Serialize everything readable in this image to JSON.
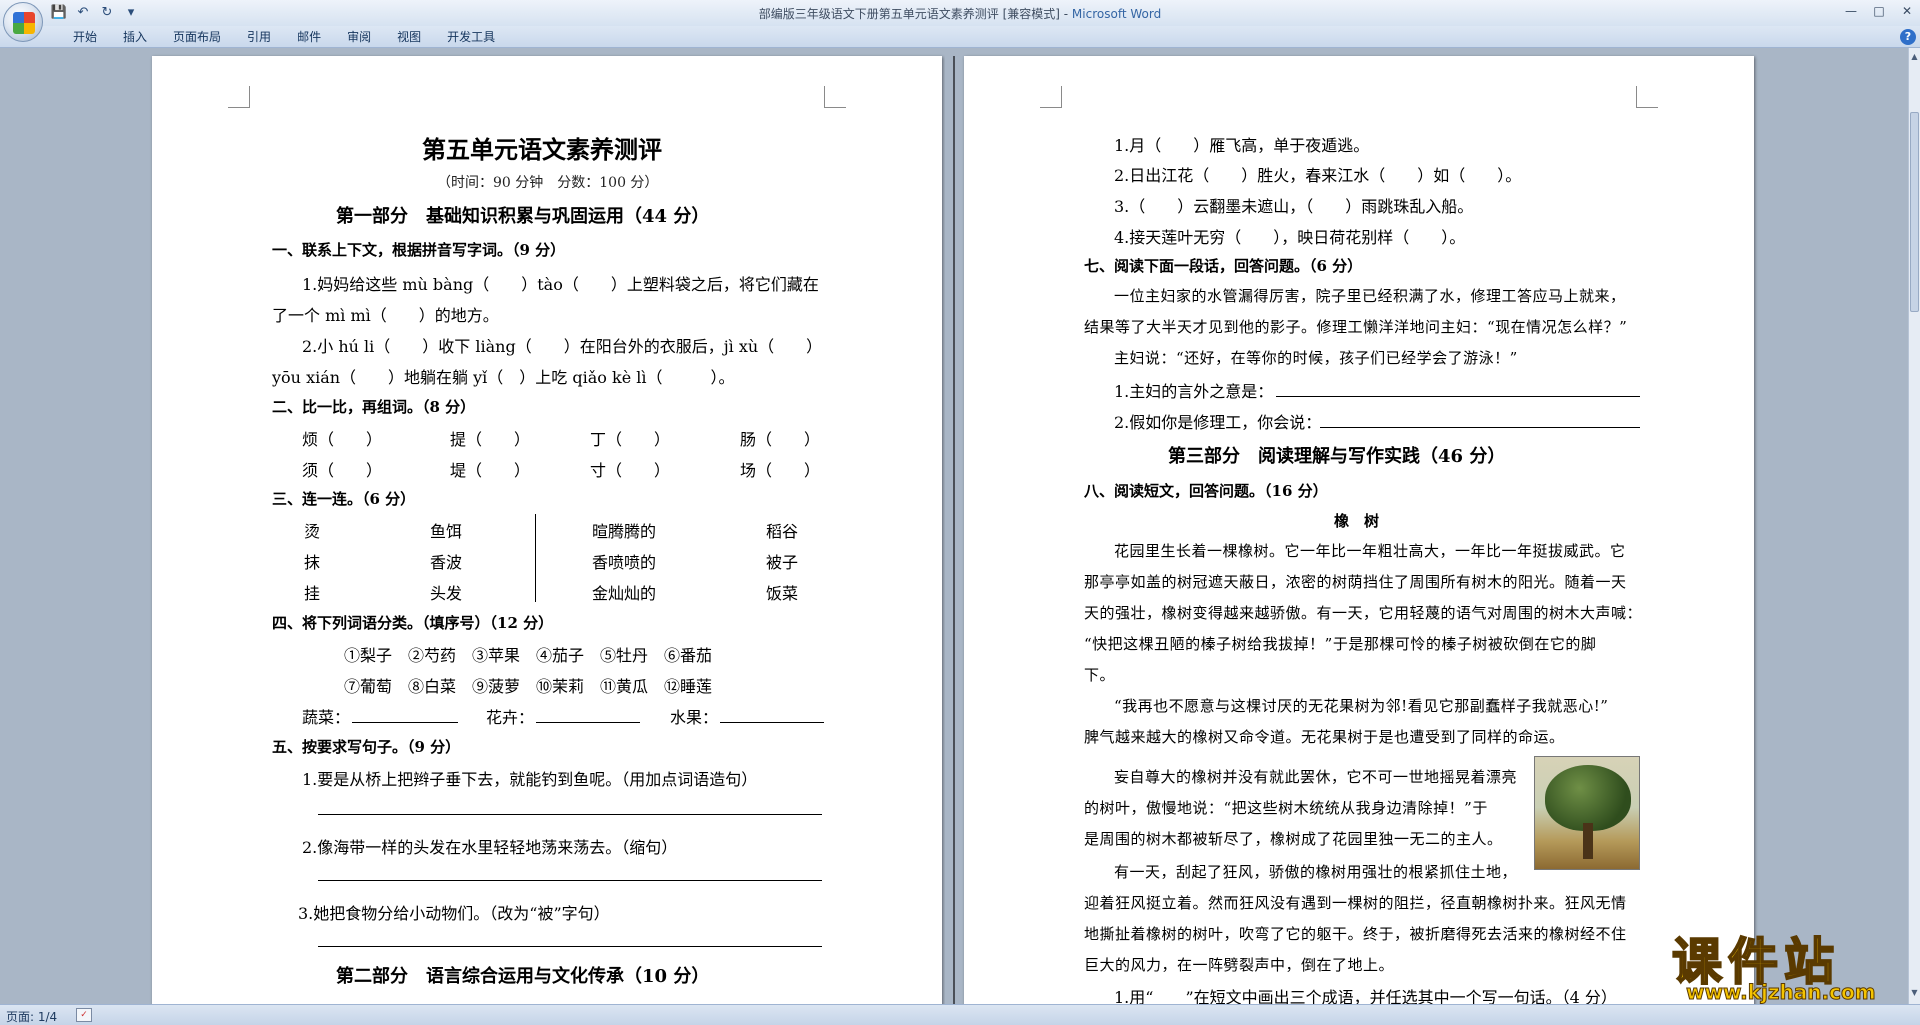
{
  "window": {
    "title": "部编版三年级语文下册第五单元语文素养测评 [兼容模式] - ",
    "app_name": "Microsoft Word"
  },
  "ribbon": {
    "tabs": [
      "开始",
      "插入",
      "页面布局",
      "引用",
      "邮件",
      "审阅",
      "视图",
      "开发工具"
    ],
    "help": "?"
  },
  "status": {
    "page": "页面: 1/4"
  },
  "watermark": {
    "text": "课件站",
    "url": "www.kjzhan.com"
  },
  "page_left": {
    "title": "第五单元语文素养测评",
    "subtitle": "（时间：90 分钟　分数：100 分）",
    "part1": "第一部分　基础知识积累与巩固运用（44 分）",
    "s1": "一、联系上下文，根据拼音写字词。（9 分）",
    "s1_l1": "1.妈妈给这些 mù bàng（　　）tào（　　）上塑料袋之后，将它们藏在",
    "s1_l2": "了一个 mì mì（　　）的地方。",
    "s1_l3": "2.小 hú li（　　）收下 liàng（　　）在阳台外的衣服后，jì xù（　　）",
    "s1_l4": "yōu xián（　　）地躺在躺 yǐ（　）上吃 qiǎo kè lì（　　　）。",
    "s2": "二、比一比，再组词。（8 分）",
    "s2_row1": [
      "烦（　　）",
      "提（　　）",
      "丁（　　）",
      "肠（　　）"
    ],
    "s2_row2": [
      "须（　　）",
      "堤（　　）",
      "寸（　　）",
      "场（　　）"
    ],
    "s3": "三、连一连。（6 分）",
    "s3_left": [
      "烫",
      "抹",
      "挂"
    ],
    "s3_left2": [
      "鱼饵",
      "香波",
      "头发"
    ],
    "s3_right": [
      "暄腾腾的",
      "香喷喷的",
      "金灿灿的"
    ],
    "s3_right2": [
      "稻谷",
      "被子",
      "饭菜"
    ],
    "s4": "四、将下列词语分类。（填序号）（12 分）",
    "s4_row1": "①梨子　②芍药　③苹果　④茄子　⑤牡丹　⑥番茄",
    "s4_row2": "⑦葡萄　⑧白菜　⑨菠萝　⑩茉莉　⑪黄瓜　⑫睡莲",
    "s4_veg": "蔬菜：",
    "s4_flower": "花卉：",
    "s4_fruit": "水果：",
    "s5": "五、按要求写句子。（9 分）",
    "s5_q1": "1.要是从桥上把辫子垂下去，就能钓到鱼呢。（用加点词语造句）",
    "s5_q2": "2.像海带一样的头发在水里轻轻地荡来荡去。（缩句）",
    "s5_q3": "3.她把食物分给小动物们。（改为“被”字句）",
    "part2": "第二部分　语言综合运用与文化传承（10 分）"
  },
  "page_right": {
    "r1": "1.月（　　）雁飞高，单于夜遁逃。",
    "r2": "2.日出江花（　　）胜火，春来江水（　　）如（　　）。",
    "r3": "3.（　　）云翻墨未遮山，（　　）雨跳珠乱入船。",
    "r4": "4.接天莲叶无穷（　　），映日荷花别样（　　）。",
    "s7": "七、阅读下面一段话，回答问题。（6 分）",
    "p7_1": "一位主妇家的水管漏得厉害，院子里已经积满了水，修理工答应马上就来，",
    "p7_2": "结果等了大半天才见到他的影子。修理工懒洋洋地问主妇：“现在情况怎么样？”",
    "p7_3": "主妇说：“还好，在等你的时候，孩子们已经学会了游泳！”",
    "q7_1": "1.主妇的言外之意是：",
    "q7_2": "2.假如你是修理工，你会说：",
    "part3": "第三部分　阅读理解与写作实践（46 分）",
    "s8": "八、阅读短文，回答问题。（16 分）",
    "story_title": "橡　树",
    "p1_1": "花园里生长着一棵橡树。它一年比一年粗壮高大，一年比一年挺拔威武。它",
    "p1_2": "那亭亭如盖的树冠遮天蔽日，浓密的树荫挡住了周围所有树木的阳光。随着一天",
    "p1_3": "天的强壮，橡树变得越来越骄傲。有一天，它用轻蔑的语气对周围的树木大声喊：",
    "p1_4": "“快把这棵丑陋的榛子树给我拔掉！”于是那棵可怜的榛子树被砍倒在它的脚",
    "p1_5": "下。",
    "p2_1": "“我再也不愿意与这棵讨厌的无花果树为邻!看见它那副蠢样子我就恶心!”",
    "p2_2": "脾气越来越大的橡树又命令道。无花果树于是也遭受到了同样的命运。",
    "p3_1": "妄自尊大的橡树并没有就此罢休，它不可一世地摇晃着漂亮",
    "p3_2": "的树叶，傲慢地说：“把这些树木统统从我身边清除掉！”于",
    "p3_3": "是周围的树木都被斩尽了，橡树成了花园里独一无二的主人。",
    "p4_1": "有一天，刮起了狂风，骄傲的橡树用强壮的根紧抓住土地，",
    "p4_2": "迎着狂风挺立着。然而狂风没有遇到一棵树的阻拦，径直朝橡树扑来。狂风无情",
    "p4_3": "地撕扯着橡树的树叶，吹弯了它的躯干。终于，被折磨得死去活来的橡树经不住",
    "p4_4": "巨大的风力，在一阵劈裂声中，倒在了地上。",
    "q8_1": "1.用“____”在短文中画出三个成语，并任选其中一个写一句话。（4 分）"
  }
}
